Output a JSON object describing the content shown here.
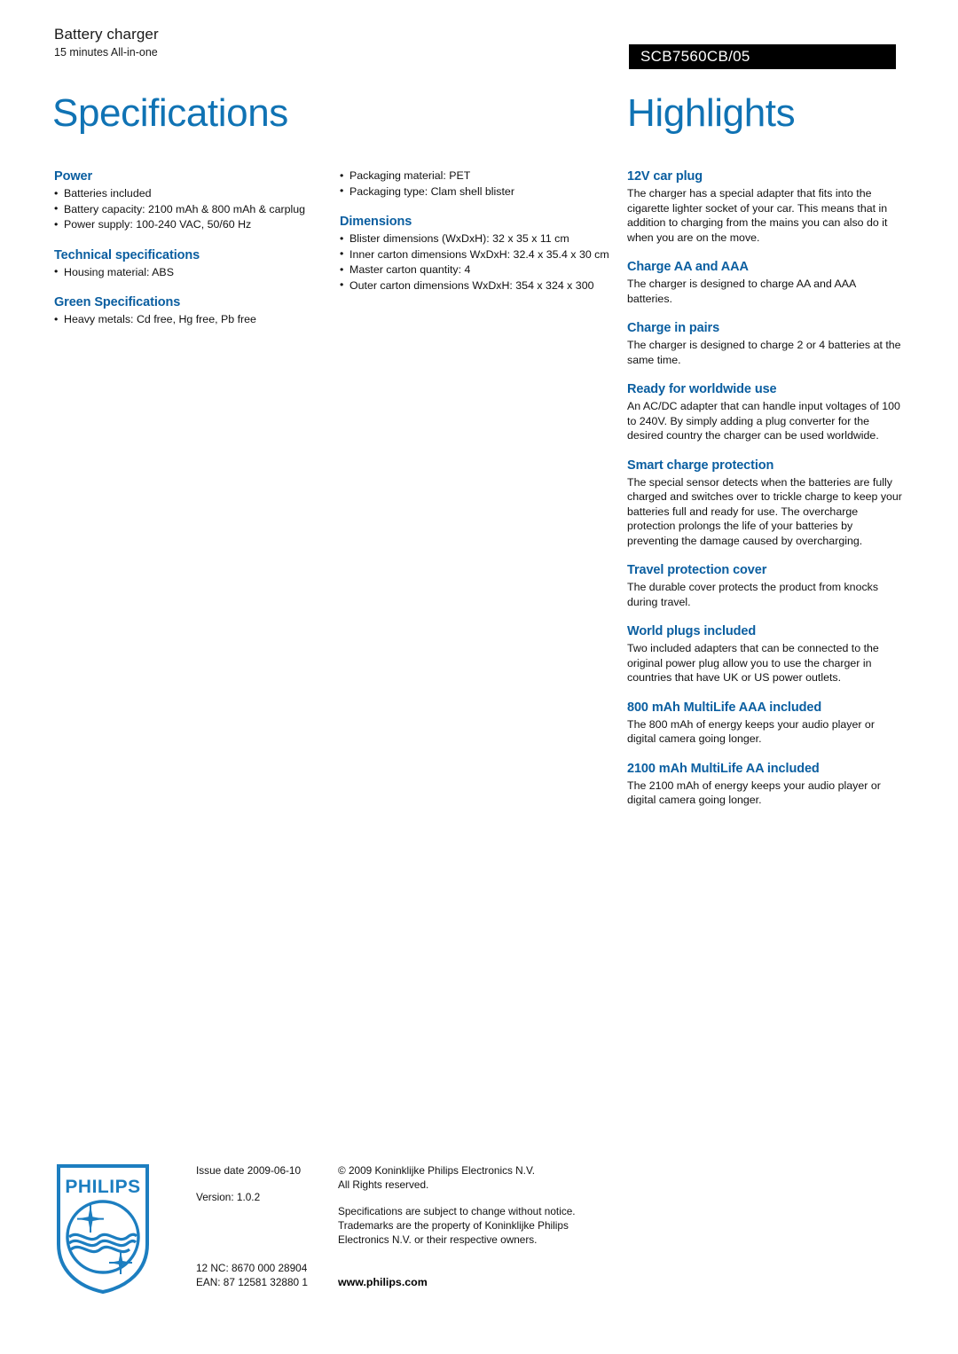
{
  "header": {
    "product_name": "Battery charger",
    "product_tagline": "15 minutes All-in-one",
    "model_code": "SCB7560CB/05"
  },
  "titles": {
    "specifications": "Specifications",
    "highlights": "Highlights"
  },
  "colors": {
    "page_title_blue": "#1073B4",
    "section_heading_blue": "#0A5EA0",
    "banner_black": "#000000",
    "logo_blue": "#1C7EC0"
  },
  "specifications": {
    "column_a": [
      {
        "heading": "Power",
        "items": [
          "Batteries included",
          "Battery capacity: 2100 mAh & 800 mAh & carplug",
          "Power supply: 100-240 VAC, 50/60 Hz"
        ]
      },
      {
        "heading": "Technical specifications",
        "items": [
          "Housing material: ABS"
        ]
      },
      {
        "heading": "Green Specifications",
        "items": [
          "Heavy metals: Cd free, Hg free, Pb free"
        ]
      }
    ],
    "column_b": [
      {
        "heading": "",
        "items": [
          "Packaging material: PET",
          "Packaging type: Clam shell blister"
        ]
      },
      {
        "heading": "Dimensions",
        "items": [
          "Blister dimensions (WxDxH): 32 x 35 x 11 cm",
          "Inner carton dimensions WxDxH: 32.4 x 35.4 x 30 cm",
          "Master carton quantity: 4",
          "Outer carton dimensions WxDxH: 354 x 324 x 300"
        ]
      }
    ]
  },
  "highlights": [
    {
      "title": "12V car plug",
      "body": "The charger has a special adapter that fits into the cigarette lighter socket of your car. This means that in addition to charging from the mains you can also do it when you are on the move."
    },
    {
      "title": "Charge AA and AAA",
      "body": "The charger is designed to charge AA and AAA batteries."
    },
    {
      "title": "Charge in pairs",
      "body": "The charger is designed to charge 2 or 4 batteries at the same time."
    },
    {
      "title": "Ready for worldwide use",
      "body": "An AC/DC adapter that can handle input voltages of 100 to 240V. By simply adding a plug converter for the desired country the charger can be used worldwide."
    },
    {
      "title": "Smart charge protection",
      "body": "The special sensor detects when the batteries are fully charged and switches over to trickle charge to keep your batteries full and ready for use. The overcharge protection prolongs the life of your batteries by preventing the damage caused by overcharging."
    },
    {
      "title": "Travel protection cover",
      "body": "The durable cover protects the product from knocks during travel."
    },
    {
      "title": "World plugs included",
      "body": "Two included adapters that can be connected to the original power plug allow you to use the charger in countries that have UK or US power outlets."
    },
    {
      "title": "800 mAh MultiLife AAA included",
      "body": "The 800 mAh of energy keeps your audio player or digital camera going longer."
    },
    {
      "title": "2100 mAh MultiLife AA included",
      "body": "The 2100 mAh of energy keeps your audio player or digital camera going longer."
    }
  ],
  "footer": {
    "logo_wordmark": "PHILIPS",
    "issue_date": "Issue date 2009-06-10",
    "version": "Version: 1.0.2",
    "nc_code": "12 NC: 8670 000 28904",
    "ean_code": "EAN: 87 12581 32880 1",
    "copyright_line1": "© 2009 Koninklijke Philips Electronics N.V.",
    "copyright_line2": "All Rights reserved.",
    "disclaimer": "Specifications are subject to change without notice. Trademarks are the property of Koninklijke Philips Electronics N.V. or their respective owners.",
    "website": "www.philips.com"
  }
}
